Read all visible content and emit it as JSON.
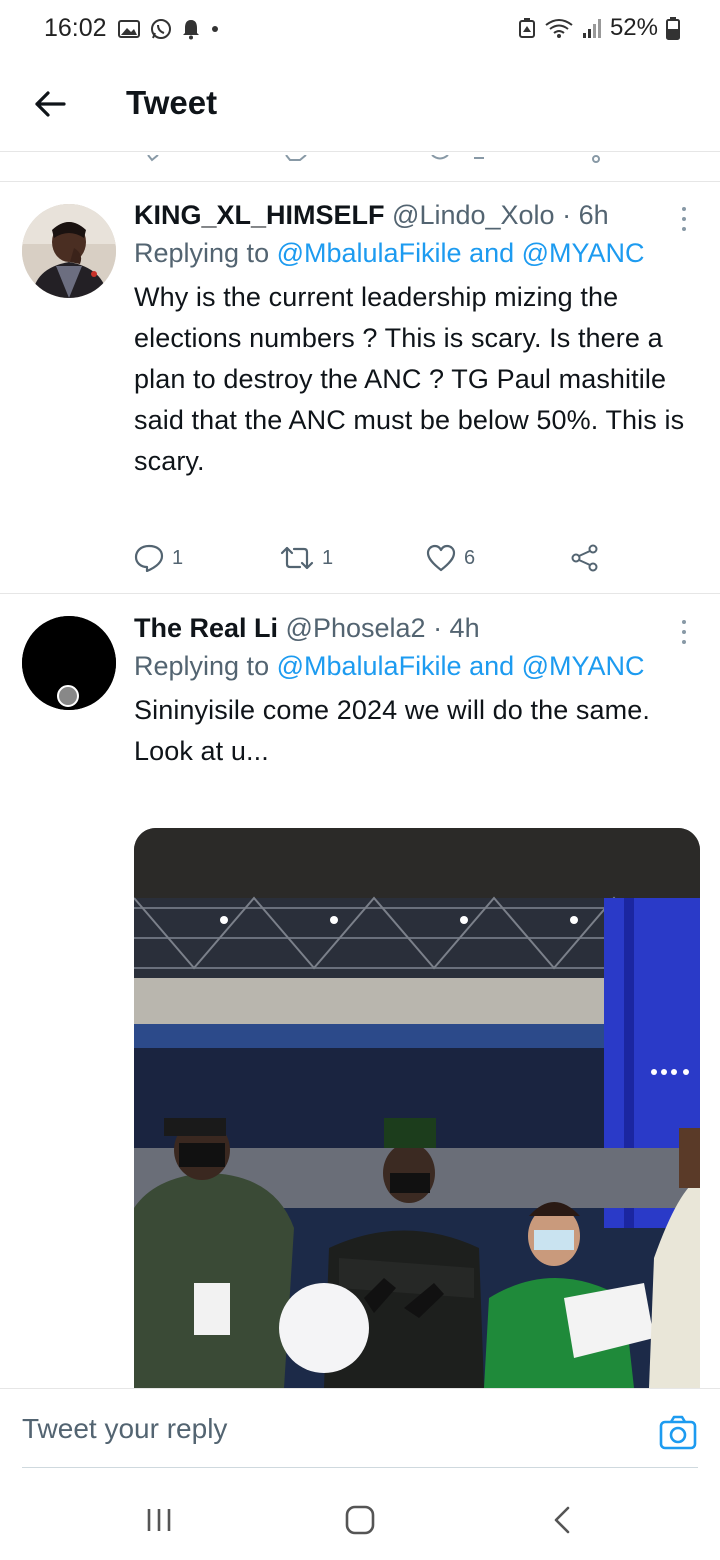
{
  "status_bar": {
    "time": "16:02",
    "battery": "52%",
    "icons": [
      "gallery-icon",
      "whatsapp-icon",
      "notification-bell-icon",
      "dot-icon",
      "battery-saver-icon",
      "wifi-icon",
      "signal-icon",
      "battery-icon"
    ]
  },
  "header": {
    "back_icon": "arrow-left-icon",
    "title": "Tweet"
  },
  "tweets": [
    {
      "name": "KING_XL_HIMSELF",
      "handle": "@Lindo_Xolo",
      "time": "· 6h",
      "replying_prefix": "Replying to",
      "replying_to": "@MbalulaFikile and @MYANC",
      "text": "Why is the current leadership mizing the elections numbers ? This is scary. Is there a plan to destroy the ANC ? TG Paul mashitile said that the ANC must be below 50%. This is scary.",
      "replies": "1",
      "retweets": "1",
      "likes": "6"
    },
    {
      "name": "The Real Li",
      "handle": "@Phosela2",
      "time": "· 4h",
      "replying_prefix": "Replying to",
      "replying_to": "@MbalulaFikile and @MYANC",
      "text": "Sininyisile come 2024 we will do the same. Look at u..."
    }
  ],
  "reply_box": {
    "placeholder": "Tweet your reply",
    "camera_icon": "camera-icon"
  },
  "nav_bar": {
    "icons": [
      "recent-apps-icon",
      "home-icon",
      "back-icon"
    ]
  },
  "colors": {
    "link": "#1d9bf0",
    "secondary_text": "#536471",
    "primary_text": "#0f1419"
  }
}
